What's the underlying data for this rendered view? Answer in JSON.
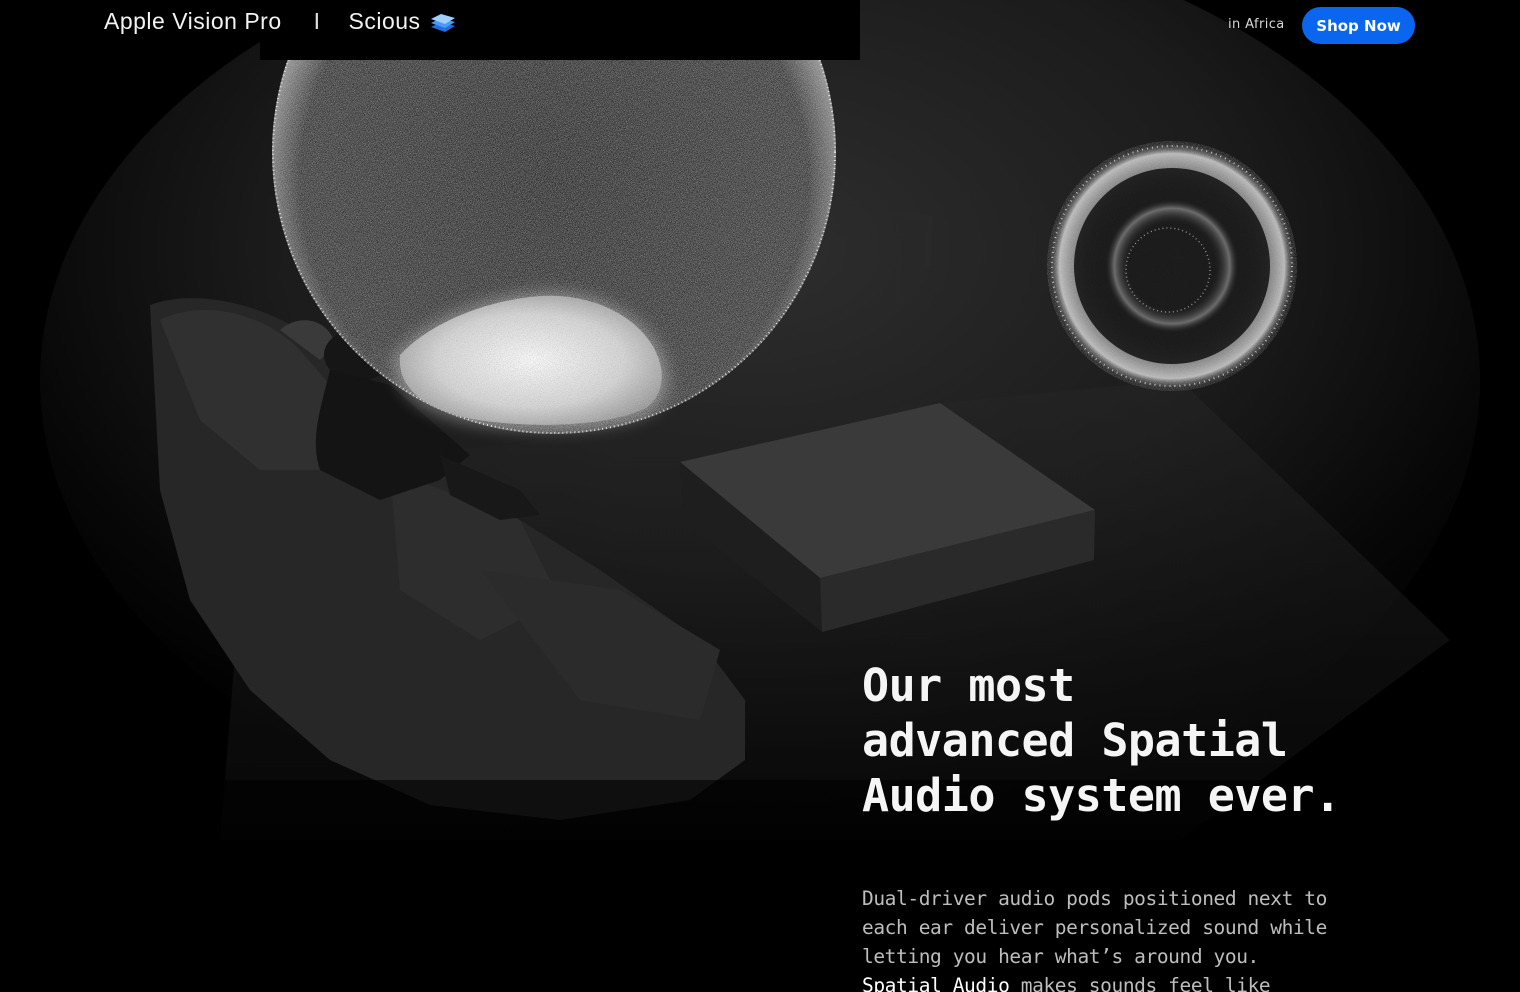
{
  "header": {
    "product": "Apple Vision Pro",
    "separator": "I",
    "retailer": "Scious",
    "region": "in Africa",
    "cta_label": "Shop Now"
  },
  "hero": {
    "headline_lines": [
      "Our most",
      "advanced Spatial",
      "Audio system ever."
    ],
    "body_lead": "Dual-driver audio pods positioned next to each ear deliver personalized sound while letting you hear what’s around you.",
    "body_link": "Spatial Audio",
    "body_tail": "makes sounds feel like"
  },
  "colors": {
    "background": "#000000",
    "accent": "#0a66ee"
  },
  "icons": {
    "brand_logo": "stacked-layers-icon"
  }
}
